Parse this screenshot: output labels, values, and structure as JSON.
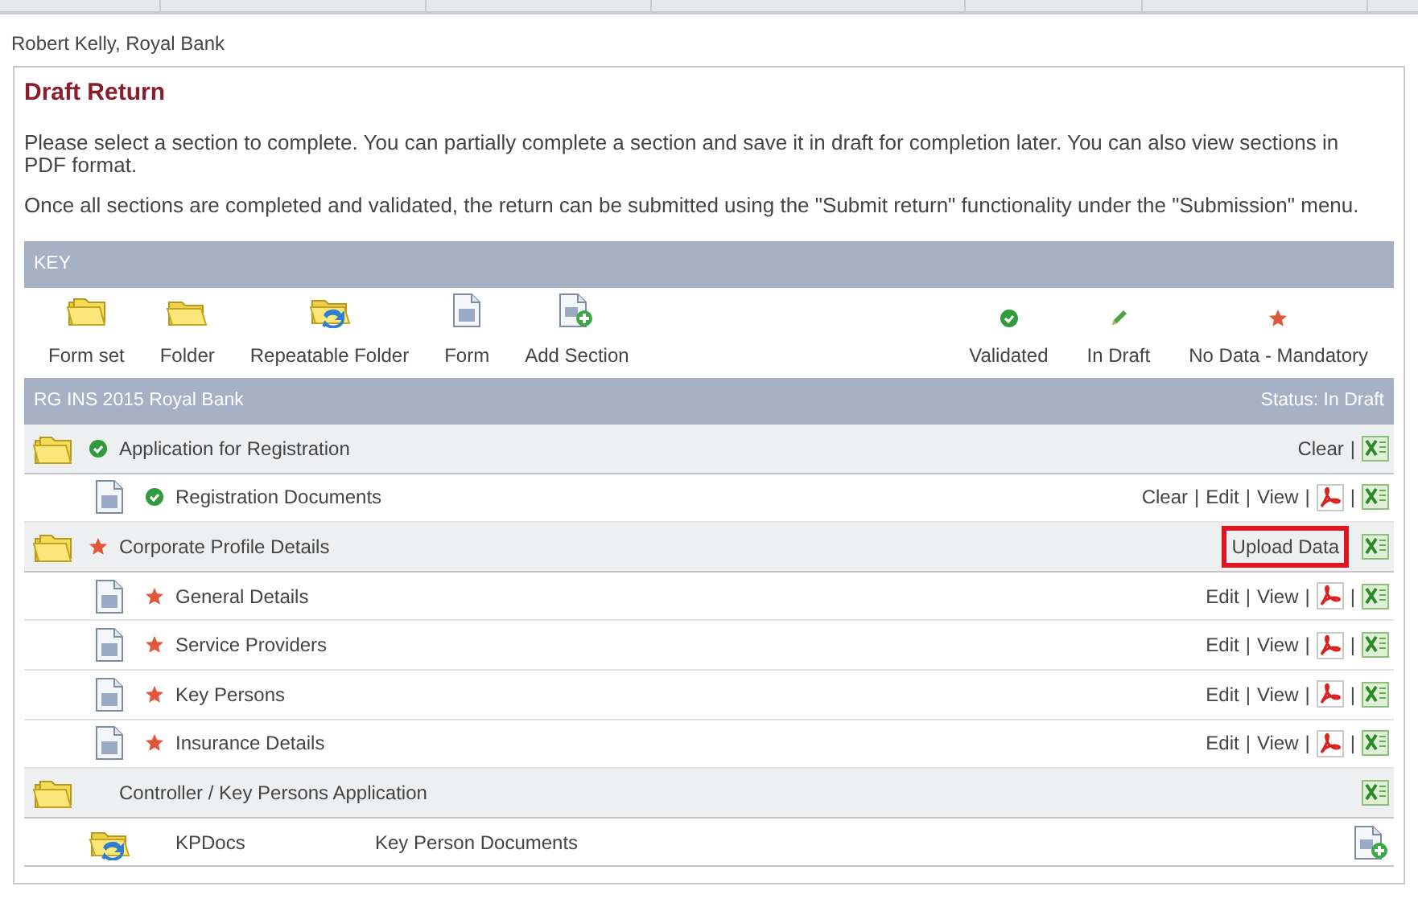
{
  "user": "Robert Kelly, Royal Bank",
  "panel": {
    "title": "Draft Return",
    "paragraphs": [
      "Please select a section to complete. You can partially complete a section and save it in draft for completion later. You can also view sections in PDF format.",
      "Once all sections are completed and validated, the return can be submitted using the \"Submit return\" functionality under the \"Submission\" menu."
    ]
  },
  "key": {
    "title": "KEY",
    "items": [
      {
        "kind": "formset",
        "label": "Form set"
      },
      {
        "kind": "folder",
        "label": "Folder"
      },
      {
        "kind": "repeatable",
        "label": "Repeatable Folder"
      },
      {
        "kind": "form",
        "label": "Form"
      },
      {
        "kind": "add",
        "label": "Add Section"
      },
      {
        "kind": "validated",
        "label": "Validated"
      },
      {
        "kind": "draft",
        "label": "In Draft"
      },
      {
        "kind": "mandatory",
        "label": "No Data - Mandatory"
      }
    ]
  },
  "return": {
    "title": "RG INS 2015 Royal Bank",
    "status": "Status: In Draft",
    "rows": [
      {
        "kind": "formset",
        "validated": true,
        "mandatory": false,
        "name": "Application for Registration",
        "actions": [
          {
            "kind": "link",
            "label": "Clear"
          },
          {
            "kind": "sep",
            "label": "|"
          },
          {
            "kind": "excel"
          }
        ]
      },
      {
        "kind": "form",
        "validated": true,
        "mandatory": false,
        "name": "Registration Documents",
        "actions": [
          {
            "kind": "link",
            "label": "Clear"
          },
          {
            "kind": "sep",
            "label": "|"
          },
          {
            "kind": "link",
            "label": "Edit"
          },
          {
            "kind": "sep",
            "label": "|"
          },
          {
            "kind": "link",
            "label": "View"
          },
          {
            "kind": "sep",
            "label": "|"
          },
          {
            "kind": "pdf"
          },
          {
            "kind": "sep",
            "label": "|"
          },
          {
            "kind": "excel"
          }
        ]
      },
      {
        "kind": "formset",
        "validated": false,
        "mandatory": true,
        "name": "Corporate Profile Details",
        "actions": [
          {
            "kind": "link",
            "label": "Upload Data",
            "highlighted": true
          },
          {
            "kind": "excel"
          }
        ]
      },
      {
        "kind": "form",
        "validated": false,
        "mandatory": true,
        "name": "General Details",
        "actions": [
          {
            "kind": "link",
            "label": "Edit"
          },
          {
            "kind": "sep",
            "label": "|"
          },
          {
            "kind": "link",
            "label": "View"
          },
          {
            "kind": "sep",
            "label": "|"
          },
          {
            "kind": "pdf"
          },
          {
            "kind": "sep",
            "label": "|"
          },
          {
            "kind": "excel"
          }
        ]
      },
      {
        "kind": "form",
        "validated": false,
        "mandatory": true,
        "name": "Service Providers",
        "actions": [
          {
            "kind": "link",
            "label": "Edit"
          },
          {
            "kind": "sep",
            "label": "|"
          },
          {
            "kind": "link",
            "label": "View"
          },
          {
            "kind": "sep",
            "label": "|"
          },
          {
            "kind": "pdf"
          },
          {
            "kind": "sep",
            "label": "|"
          },
          {
            "kind": "excel"
          }
        ]
      },
      {
        "kind": "form",
        "validated": false,
        "mandatory": true,
        "name": "Key Persons",
        "actions": [
          {
            "kind": "link",
            "label": "Edit"
          },
          {
            "kind": "sep",
            "label": "|"
          },
          {
            "kind": "link",
            "label": "View"
          },
          {
            "kind": "sep",
            "label": "|"
          },
          {
            "kind": "pdf"
          },
          {
            "kind": "sep",
            "label": "|"
          },
          {
            "kind": "excel"
          }
        ]
      },
      {
        "kind": "form",
        "validated": false,
        "mandatory": true,
        "name": "Insurance Details",
        "actions": [
          {
            "kind": "link",
            "label": "Edit"
          },
          {
            "kind": "sep",
            "label": "|"
          },
          {
            "kind": "link",
            "label": "View"
          },
          {
            "kind": "sep",
            "label": "|"
          },
          {
            "kind": "pdf"
          },
          {
            "kind": "sep",
            "label": "|"
          },
          {
            "kind": "excel"
          }
        ]
      },
      {
        "kind": "formset",
        "validated": false,
        "mandatory": false,
        "name": "Controller / Key Persons Application",
        "actions": [
          {
            "kind": "excel"
          }
        ]
      },
      {
        "kind": "repeatable",
        "validated": false,
        "mandatory": false,
        "name": "KPDocs",
        "description": "Key Person Documents",
        "actions": [
          {
            "kind": "add"
          }
        ]
      }
    ]
  }
}
